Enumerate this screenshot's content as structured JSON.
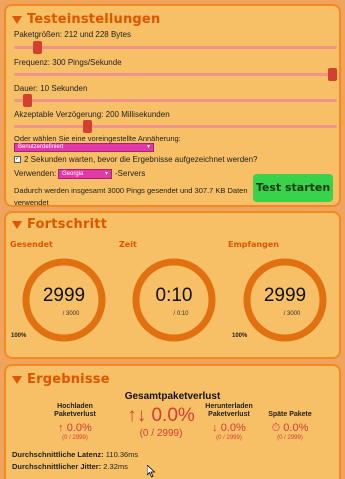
{
  "settings": {
    "title": "Testeinstellungen",
    "packet_size_label": "Paketgrößen: 212 und 228 Bytes",
    "frequency_label": "Frequenz: 300 Pings/Sekunde",
    "duration_label": "Dauer: 10 Sekunden",
    "delay_label": "Akzeptable Verzögerung: 200 Millisekunden",
    "slider_levels": {
      "packet_size": 0.06,
      "frequency": 1.0,
      "duration": 0.03,
      "delay": 0.22
    },
    "preset_prompt": "Oder wählen Sie eine voreingestellte Annäherung:",
    "preset_value": "Benutzerdefiniert",
    "wait_checkbox_label": "2 Sekunden warten, bevor die Ergebnisse aufgezeichnet werden?",
    "wait_checked": true,
    "use_label": "Verwenden:",
    "server_value": "Georgia",
    "servers_suffix": "-Servers",
    "summary": "Dadurch werden insgesamt 3000 Pings gesendet und 307.7 KB Daten",
    "summary_cut": "verwendet",
    "start_button": "Test starten"
  },
  "progress": {
    "title": "Fortschritt",
    "gauges": [
      {
        "label": "Gesendet",
        "value": "2999",
        "sub": "/ 3000",
        "pct": "100%",
        "level": 1.0
      },
      {
        "label": "Zeit",
        "value": "0:10",
        "sub": "/ 0:10",
        "pct": "",
        "level": 1.0
      },
      {
        "label": "Empfangen",
        "value": "2999",
        "sub": "/ 3000",
        "pct": "100%",
        "level": 1.0
      }
    ]
  },
  "results": {
    "title": "Ergebnisse",
    "total_loss_title": "Gesamtpaketverlust",
    "upload_head_1": "Hochladen",
    "upload_head_2": "Paketverlust",
    "upload_value": "↑ 0.0%",
    "upload_sub": "(0 / 2999)",
    "total_value": "↑↓ 0.0%",
    "total_sub": "(0 / 2999)",
    "download_head_1": "Herunterladen",
    "download_head_2": "Paketverlust",
    "download_value": "↓ 0.0%",
    "download_sub": "(0 / 2999)",
    "late_head": "Späte Pakete",
    "late_value": "⏱ 0.0%",
    "late_sub": "(0 / 2999)",
    "latency_label": "Durchschnittliche Latenz:",
    "latency_value": "110.36ms",
    "jitter_label": "Durchschnittlicher Jitter:",
    "jitter_value": "2.32ms"
  },
  "colors": {
    "page_bg": "#f0a35c",
    "panel_bg": "#f7c066",
    "accent": "#e05500",
    "gauge_ring": "#e07010",
    "start_button": "#38d24b",
    "loss_red": "#d53a3a"
  }
}
